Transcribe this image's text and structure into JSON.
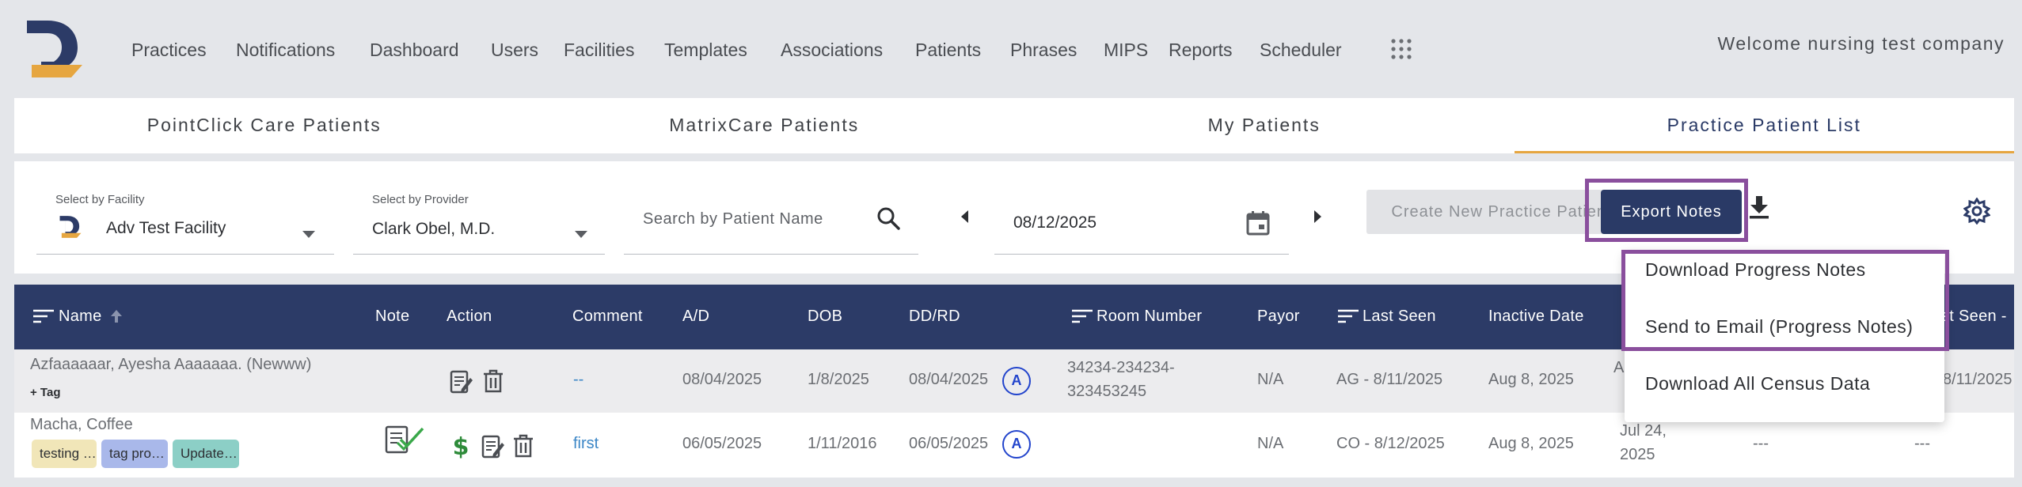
{
  "nav": {
    "items": [
      "Practices",
      "Notifications",
      "Dashboard",
      "Users",
      "Facilities",
      "Templates",
      "Associations",
      "Patients",
      "Phrases",
      "MIPS",
      "Reports",
      "Scheduler"
    ],
    "welcome": "Welcome nursing test company"
  },
  "tabs": [
    "PointClick Care Patients",
    "MatrixCare Patients",
    "My Patients",
    "Practice Patient List"
  ],
  "filters": {
    "facility_label": "Select by Facility",
    "facility_value": "Adv Test Facility",
    "provider_label": "Select by Provider",
    "provider_value": "Clark Obel, M.D.",
    "search_placeholder": "Search by Patient Name",
    "date": "08/12/2025",
    "create_button": "Create New Practice Patient list",
    "export_button": "Export Notes"
  },
  "table": {
    "headers": {
      "name": "Name",
      "note": "Note",
      "action": "Action",
      "comment": "Comment",
      "ad": "A/D",
      "dob": "DOB",
      "ddrd": "DD/RD",
      "room": "Room Number",
      "payor": "Payor",
      "last_seen": "Last Seen",
      "inactive": "Inactive Date",
      "last_seen_cut": "st Seen -"
    },
    "rows": [
      {
        "name": "Azfaaaaaar, Ayesha Aaaaaaa. (Newww)",
        "tag_link": "+ Tag",
        "comment": "--",
        "ad": "08/04/2025",
        "dob": "1/8/2025",
        "ddrd": "08/04/2025",
        "badge": "A",
        "room_line1": "34234-234234-",
        "room_line2": "323453245",
        "payor": "N/A",
        "last_seen": "AG - 8/11/2025",
        "inactive": "Aug 8, 2025",
        "partial_a": "A",
        "partial_end": "8/11/2025"
      },
      {
        "name": "Macha, Coffee",
        "tags": [
          "testing …",
          "tag pro…",
          "Update…"
        ],
        "comment": "first",
        "ad": "06/05/2025",
        "dob": "1/11/2016",
        "ddrd": "06/05/2025",
        "badge": "A",
        "payor": "N/A",
        "last_seen": "CO - 8/12/2025",
        "inactive": "Aug 8, 2025",
        "extra_line1": "Jul 24,",
        "extra_line2": "2025",
        "dash1": "---",
        "dash2": "---"
      }
    ]
  },
  "dropdown": {
    "items": [
      "Download Progress Notes",
      "Send to Email (Progress Notes)",
      "Download All Census Data"
    ]
  },
  "colors": {
    "primary": "#2c3b67",
    "accent": "#e6a640",
    "highlight": "#8a4f9d",
    "link": "#3b86c6",
    "badge": "#2244cc",
    "tag1": "#f1e6b8",
    "tag2": "#a9b8ea",
    "tag3": "#8ccfc6"
  }
}
